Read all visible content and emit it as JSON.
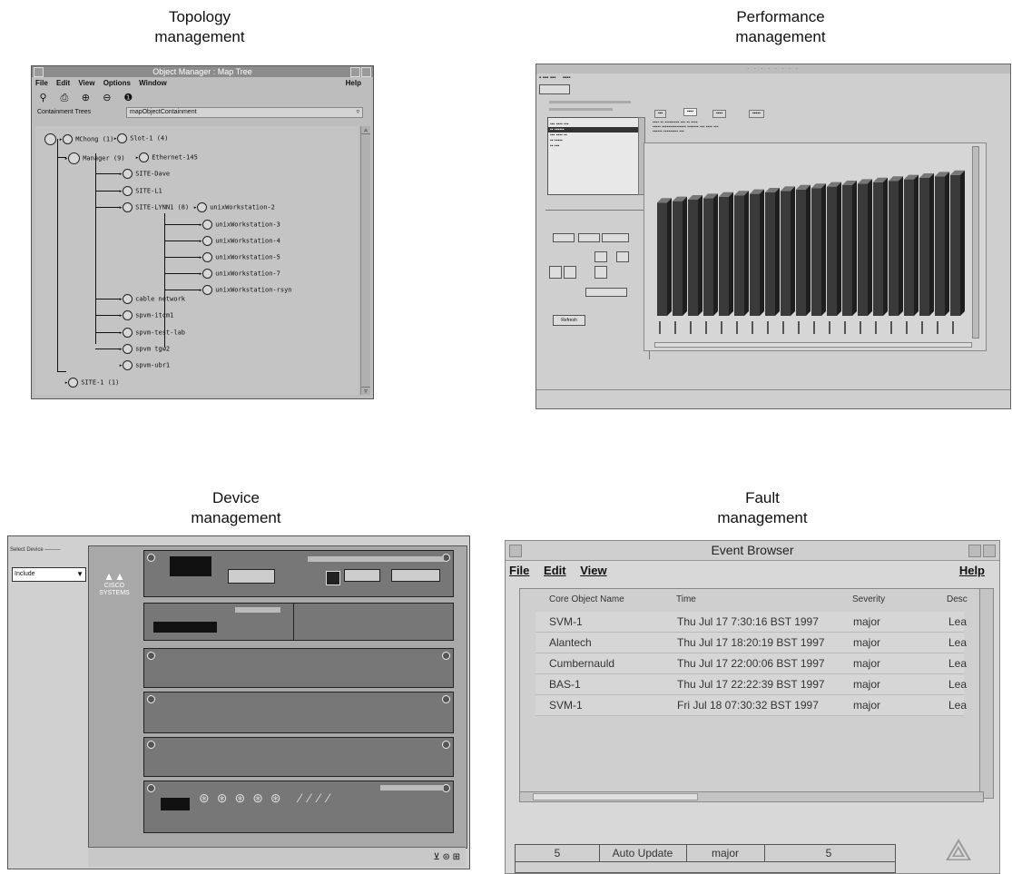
{
  "captions": {
    "topology": [
      "Topology",
      "management"
    ],
    "performance": [
      "Performance",
      "management"
    ],
    "device": [
      "Device",
      "management"
    ],
    "fault": [
      "Fault",
      "management"
    ]
  },
  "topology": {
    "window_title": "Object Manager : Map Tree",
    "menu": [
      "File",
      "Edit",
      "View",
      "Options",
      "Window"
    ],
    "help": "Help",
    "containment_label": "Containment Trees",
    "containment_value": "mapObjectContainment",
    "nodes": {
      "root": "MChong (1)",
      "slot": "Slot-1 (4)",
      "manager": "Manager (9)",
      "ethernet": "Ethernet-145",
      "site_dave": "SITE-Dave",
      "site_l1": "SITE-L1",
      "site_lynn": "SITE-LYNN1 (8)",
      "ws2": "unixWorkstation-2",
      "ws3": "unixWorkstation-3",
      "ws4": "unixWorkstation-4",
      "ws5": "unixWorkstation-5",
      "ws7": "unixWorkstation-7",
      "wsr": "unixWorkstation-rsyn",
      "cable": "cable network",
      "itcm": "spvm-itcm1",
      "testlab": "spvm-test-lab",
      "tgw2": "spvm tgw2",
      "ubr1": "spvm-ubr1",
      "site1": "SITE-1 (1)"
    }
  },
  "performance": {
    "bar_count": 20,
    "bar_heights": [
      0.78,
      0.79,
      0.8,
      0.81,
      0.82,
      0.83,
      0.84,
      0.85,
      0.86,
      0.87,
      0.88,
      0.89,
      0.9,
      0.91,
      0.92,
      0.93,
      0.94,
      0.95,
      0.96,
      0.97
    ],
    "bar_color": "#3a3a3a",
    "button": "Refresh"
  },
  "device": {
    "group_label": "Select Device",
    "select_value": "Include",
    "logo": "CISCO SYSTEMS"
  },
  "fault": {
    "window_title": "Event Browser",
    "menu": [
      "File",
      "Edit",
      "View"
    ],
    "help": "Help",
    "columns": [
      "Core Object Name",
      "Time",
      "Severity",
      "Desc"
    ],
    "rows": [
      {
        "name": "SVM-1",
        "time": "Thu Jul 17  7:30:16 BST 1997",
        "sev": "major",
        "desc": "Lea"
      },
      {
        "name": "Alantech",
        "time": "Thu Jul 17  18:20:19 BST 1997",
        "sev": "major",
        "desc": "Lea"
      },
      {
        "name": "Cumbernauld",
        "time": "Thu Jul 17  22:00:06 BST 1997",
        "sev": "major",
        "desc": "Lea"
      },
      {
        "name": "BAS-1",
        "time": "Thu Jul 17  22:22:39 BST 1997",
        "sev": "major",
        "desc": "Lea"
      },
      {
        "name": "SVM-1",
        "time": "Fri Jul 18  07:30:32 BST 1997",
        "sev": "major",
        "desc": "Lea"
      }
    ],
    "status": [
      "5",
      "Auto Update",
      "major",
      "5"
    ]
  }
}
